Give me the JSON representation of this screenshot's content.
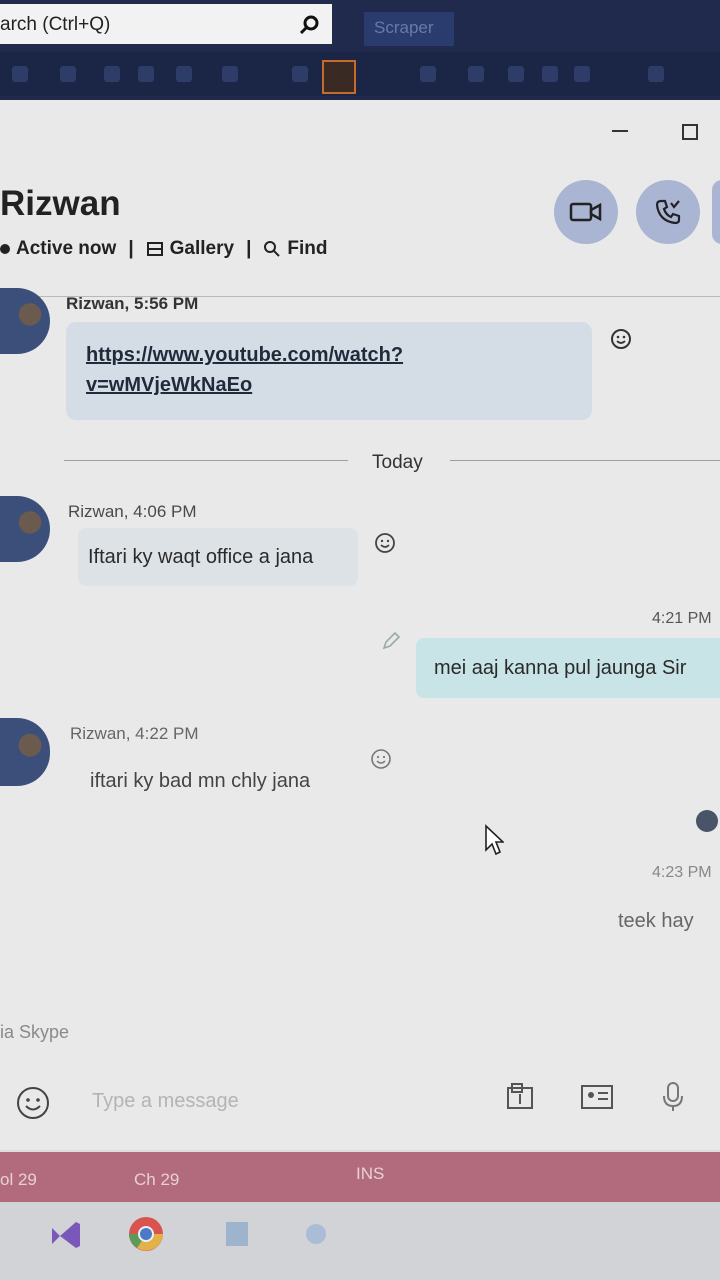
{
  "topbar": {
    "search_text": "arch (Ctrl+Q)",
    "app_name": "Scraper"
  },
  "header": {
    "contact_name": "Rizwan",
    "status": "Active now",
    "gallery": "Gallery",
    "find": "Find",
    "separator": "|"
  },
  "messages": [
    {
      "meta": "Rizwan, 5:56 PM",
      "text_line1": "https://www.youtube.com/watch?",
      "text_line2": "v=wMVjeWkNaEo"
    },
    {
      "meta": "Rizwan, 4:06 PM",
      "text": "Iftari ky waqt office a jana"
    },
    {
      "time": "4:21 PM",
      "text": "mei aaj kanna pul jaunga Sir"
    },
    {
      "meta": "Rizwan, 4:22 PM",
      "text": "iftari ky bad mn chly jana"
    },
    {
      "time": "4:23 PM",
      "text": "teek hay"
    }
  ],
  "divider": {
    "label": "Today"
  },
  "compose": {
    "via": "ia Skype",
    "placeholder": "Type a message"
  },
  "statusbar": {
    "col": "ol 29",
    "ch": "Ch 29",
    "mode": "INS"
  },
  "colors": {
    "topbar": "#1f2a4d",
    "call_button": "#aab5d4",
    "incoming_bubble": "#d4dde6",
    "outgoing_bubble": "#c8e4e6",
    "statusbar": "#b26b7c"
  }
}
